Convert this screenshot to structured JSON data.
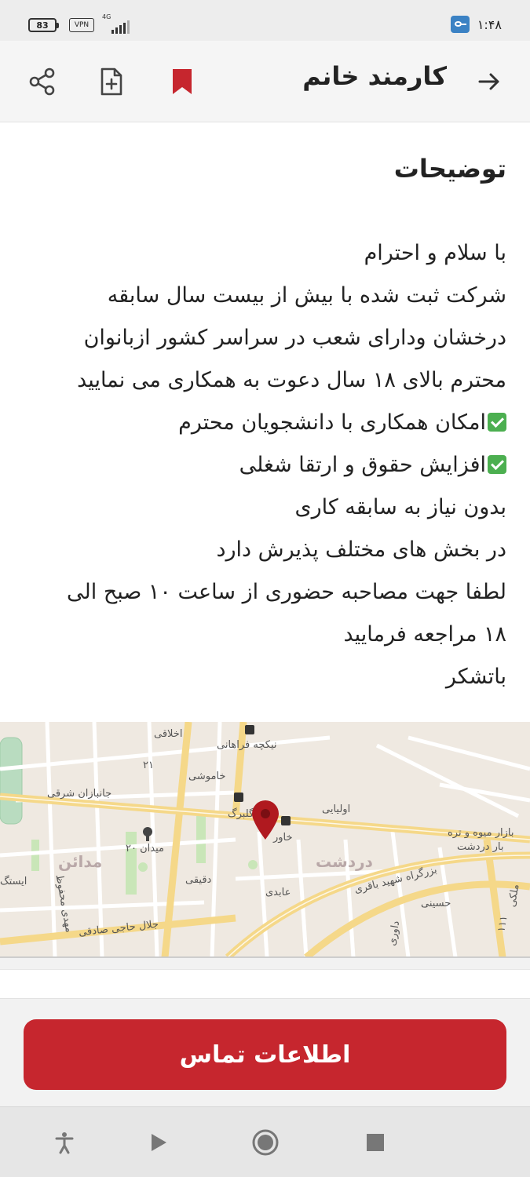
{
  "status_bar": {
    "battery": "83",
    "vpn": "VPN",
    "network": "4G",
    "time": "۱:۴۸"
  },
  "header": {
    "title": "کارمند خانم",
    "icons": [
      "back-arrow-icon",
      "bookmark-icon",
      "add-file-icon",
      "share-icon"
    ],
    "bookmark_color": "#c6262e"
  },
  "description": {
    "title": "توضیحات",
    "lines": [
      {
        "text": "با سلام و احترام",
        "check": false
      },
      {
        "text": "شرکت ثبت شده با بیش از بیست سال سابقه",
        "check": false
      },
      {
        "text": "درخشان ودارای شعب در سراسر کشور ازبانوان",
        "check": false
      },
      {
        "text": "محترم بالای ۱۸ سال دعوت به همکاری می نمایید",
        "check": false
      },
      {
        "text": "امکان همکاری با دانشجویان محترم",
        "check": true
      },
      {
        "text": "افزایش حقوق و ارتقا شغلی",
        "check": true
      },
      {
        "text": "بدون نیاز به سابقه کاری",
        "check": false
      },
      {
        "text": "در بخش های مختلف پذیرش دارد",
        "check": false
      },
      {
        "text": "لطفا جهت مصاحبه حضوری از ساعت ۱۰ صبح الی",
        "check": false
      },
      {
        "text": "۱۸ مراجعه فرمایید",
        "check": false
      },
      {
        "text": "باتشکر",
        "check": false
      }
    ]
  },
  "map": {
    "labels": {
      "l1": "اخلاقی",
      "l2": "نیکچه فراهانی",
      "l3": "۲۱",
      "l4": "خاموشی",
      "l5": "جانبازان شرقی",
      "l6": "گلبرگ",
      "l7": "اولیایی",
      "l8": "خاور",
      "l9": "بازار میوه و تره",
      "l10": "بار دردشت",
      "l11": "میدان ۲۰",
      "l12": "دقیقی",
      "l13": "عابدی",
      "l14": "بزرگراه شهید باقری",
      "l15": "حسینی",
      "l16": "جلال حاجی صادقی",
      "l17": "مهدی محفوظ",
      "l18": "داوری",
      "l19": "ایستگ",
      "l20": "ملکی",
      "l21": "۱۱۱"
    },
    "districts": {
      "d1": "مدائن",
      "d2": "دردشت"
    },
    "pin_color": "#b0191f"
  },
  "footer": {
    "contact_label": "اطلاعات تماس",
    "button_color": "#c6262e"
  },
  "nav": {
    "icons": [
      "accessibility-icon",
      "back-triangle-icon",
      "home-circle-icon",
      "recents-square-icon"
    ]
  }
}
